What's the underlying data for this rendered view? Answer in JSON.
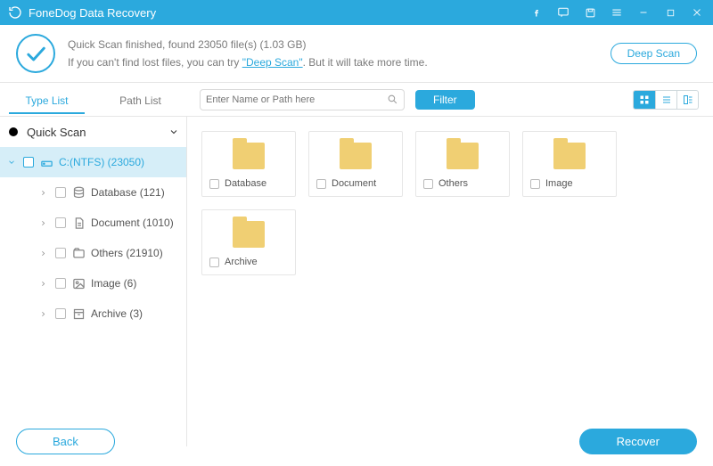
{
  "titlebar": {
    "title": "FoneDog Data Recovery"
  },
  "status": {
    "headline": "Quick Scan finished, found 23050 file(s) (1.03 GB)",
    "hint_prefix": "If you can't find lost files, you can try ",
    "hint_link": "\"Deep Scan\"",
    "hint_suffix": ". But it will take more time.",
    "deep_scan_label": "Deep Scan"
  },
  "tabs": {
    "type_list": "Type List",
    "path_list": "Path List"
  },
  "search": {
    "placeholder": "Enter Name or Path here"
  },
  "filter_label": "Filter",
  "sidebar": {
    "root_label": "Quick Scan",
    "drive_label": "C:(NTFS) (23050)",
    "children": [
      {
        "label": "Database (121)",
        "icon": "database"
      },
      {
        "label": "Document (1010)",
        "icon": "document"
      },
      {
        "label": "Others (21910)",
        "icon": "others"
      },
      {
        "label": "Image (6)",
        "icon": "image"
      },
      {
        "label": "Archive (3)",
        "icon": "archive"
      }
    ]
  },
  "grid": {
    "items": [
      {
        "label": "Database"
      },
      {
        "label": "Document"
      },
      {
        "label": "Others"
      },
      {
        "label": "Image"
      },
      {
        "label": "Archive"
      }
    ]
  },
  "bottom": {
    "back": "Back",
    "recover": "Recover"
  }
}
